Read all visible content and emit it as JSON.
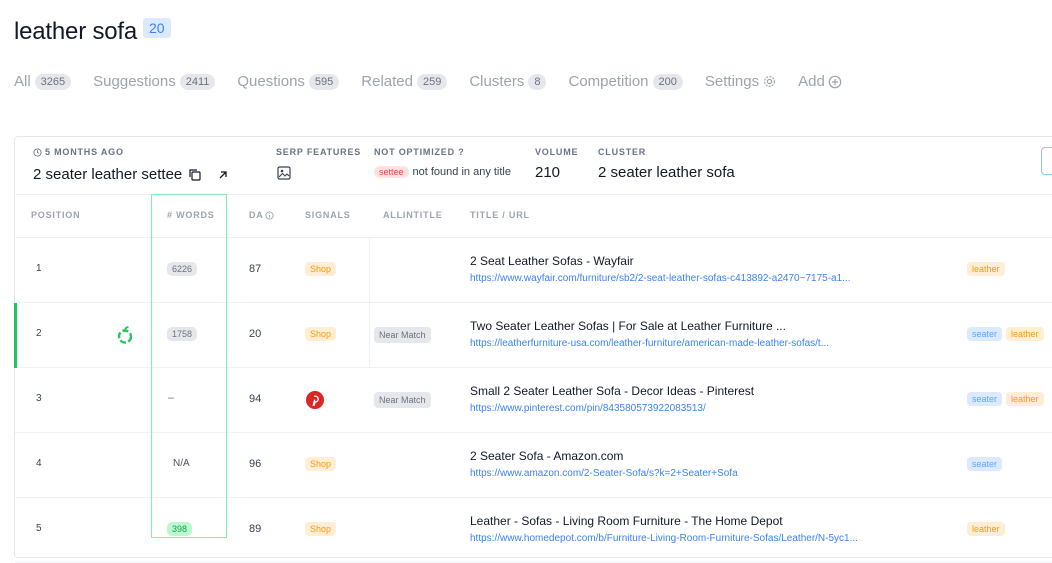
{
  "header": {
    "title": "leather sofa",
    "count": "20"
  },
  "tabs": [
    {
      "label": "All",
      "count": "3265"
    },
    {
      "label": "Suggestions",
      "count": "2411"
    },
    {
      "label": "Questions",
      "count": "595"
    },
    {
      "label": "Related",
      "count": "259"
    },
    {
      "label": "Clusters",
      "count": "8"
    },
    {
      "label": "Competition",
      "count": "200"
    },
    {
      "label": "Settings"
    },
    {
      "label": "Add"
    }
  ],
  "meta": {
    "time_ago": "5 MONTHS AGO",
    "keyword": "2 seater leather settee",
    "serp_label": "SERP FEATURES",
    "notopt_label": "NOT OPTIMIZED ?",
    "notopt_chip": "settee",
    "notopt_text": "not found in any title",
    "volume_label": "VOLUME",
    "volume": "210",
    "cluster_label": "CLUSTER",
    "cluster": "2 seater leather sofa"
  },
  "columns": [
    "POSITION",
    "# WORDS",
    "DA",
    "SIGNALS",
    "ALLINTITLE",
    "TITLE / URL"
  ],
  "rows": [
    {
      "pos": "1",
      "words": "6226",
      "da": "87",
      "signal": "Shop",
      "allintitle": "",
      "title": "2 Seat Leather Sofas - Wayfair",
      "url": "https://www.wayfair.com/furniture/sb2/2-seat-leather-sofas-c413892-a2470~7175-a1...",
      "tags": [
        {
          "text": "leather",
          "type": "orange"
        }
      ]
    },
    {
      "pos": "2",
      "words": "1758",
      "da": "20",
      "signal": "Shop",
      "allintitle": "Near Match",
      "title": "Two Seater Leather Sofas | For Sale at Leather Furniture ...",
      "url": "https://leatherfurniture-usa.com/leather-furniture/american-made-leather-sofas/t...",
      "tags": [
        {
          "text": "seater",
          "type": "blue"
        },
        {
          "text": "leather",
          "type": "orange"
        }
      ]
    },
    {
      "pos": "3",
      "words": "–",
      "da": "94",
      "signal": "pinterest",
      "allintitle": "Near Match",
      "title": "Small 2 Seater Leather Sofa - Decor Ideas - Pinterest",
      "url": "https://www.pinterest.com/pin/843580573922083513/",
      "tags": [
        {
          "text": "seater",
          "type": "blue"
        },
        {
          "text": "leather",
          "type": "orange"
        }
      ]
    },
    {
      "pos": "4",
      "words": "N/A",
      "da": "96",
      "signal": "Shop",
      "allintitle": "",
      "title": "2 Seater Sofa - Amazon.com",
      "url": "https://www.amazon.com/2-Seater-Sofa/s?k=2+Seater+Sofa",
      "tags": [
        {
          "text": "seater",
          "type": "blue"
        }
      ]
    },
    {
      "pos": "5",
      "words": "398",
      "da": "89",
      "signal": "Shop",
      "allintitle": "",
      "title": "Leather - Sofas - Living Room Furniture - The Home Depot",
      "url": "https://www.homedepot.com/b/Furniture-Living-Room-Furniture-Sofas/Leather/N-5yc1...",
      "tags": [
        {
          "text": "leather",
          "type": "orange"
        }
      ]
    }
  ]
}
